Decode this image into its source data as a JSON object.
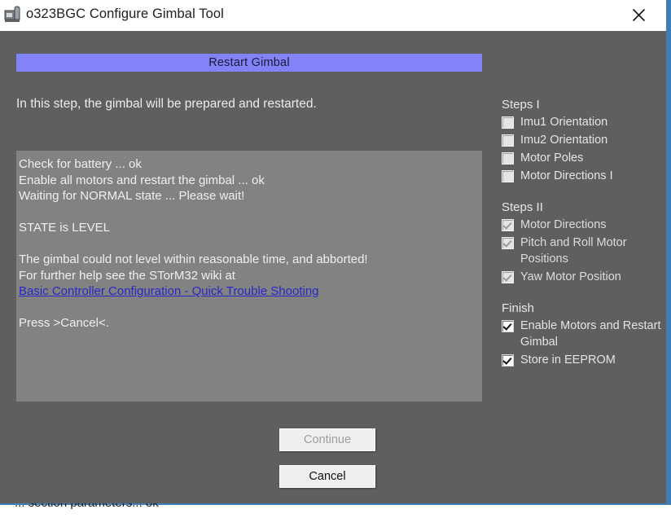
{
  "window": {
    "title": "o323BGC Configure Gimbal Tool",
    "icon": "app-icon",
    "close_icon": "close-icon"
  },
  "dialog": {
    "banner": "Restart Gimbal",
    "intro": "In this step, the gimbal will be prepared and restarted.",
    "log": {
      "lines": [
        "Check for battery ... ok",
        "Enable all motors and restart the gimbal ... ok",
        "Waiting for NORMAL state ... Please wait!",
        "",
        "STATE is LEVEL",
        "",
        "The gimbal could not level within reasonable time, and abborted!",
        "For further help see the STorM32 wiki at"
      ],
      "link": "Basic Controller Configuration - Quick Trouble Shooting",
      "lines_after": [
        "",
        "Press >Cancel<."
      ]
    },
    "buttons": {
      "continue": "Continue",
      "cancel": "Cancel"
    }
  },
  "sidebar": {
    "groups": [
      {
        "title": "Steps I",
        "items": [
          {
            "label": "Imu1 Orientation",
            "state": "empty"
          },
          {
            "label": "Imu2 Orientation",
            "state": "empty"
          },
          {
            "label": "Motor Poles",
            "state": "empty"
          },
          {
            "label": "Motor Directions I",
            "state": "empty"
          }
        ]
      },
      {
        "title": "Steps II",
        "items": [
          {
            "label": "Motor Directions",
            "state": "checked-gray"
          },
          {
            "label": "Pitch and Roll Motor Positions",
            "state": "checked-gray"
          },
          {
            "label": "Yaw Motor Position",
            "state": "checked-gray"
          }
        ]
      },
      {
        "title": "Finish",
        "items": [
          {
            "label": "Enable Motors and Restart Gimbal",
            "state": "checked"
          },
          {
            "label": "Store in EEPROM",
            "state": "checked"
          }
        ]
      }
    ]
  },
  "background_window": {
    "clipped_text": "... section  parameters... ok"
  },
  "colors": {
    "dialog_bg": "#5f5f5f",
    "log_bg": "#828282",
    "banner": "#8183f7",
    "link": "#2727c8",
    "window_edge": "#3f7fb5",
    "text": "#ededed"
  }
}
